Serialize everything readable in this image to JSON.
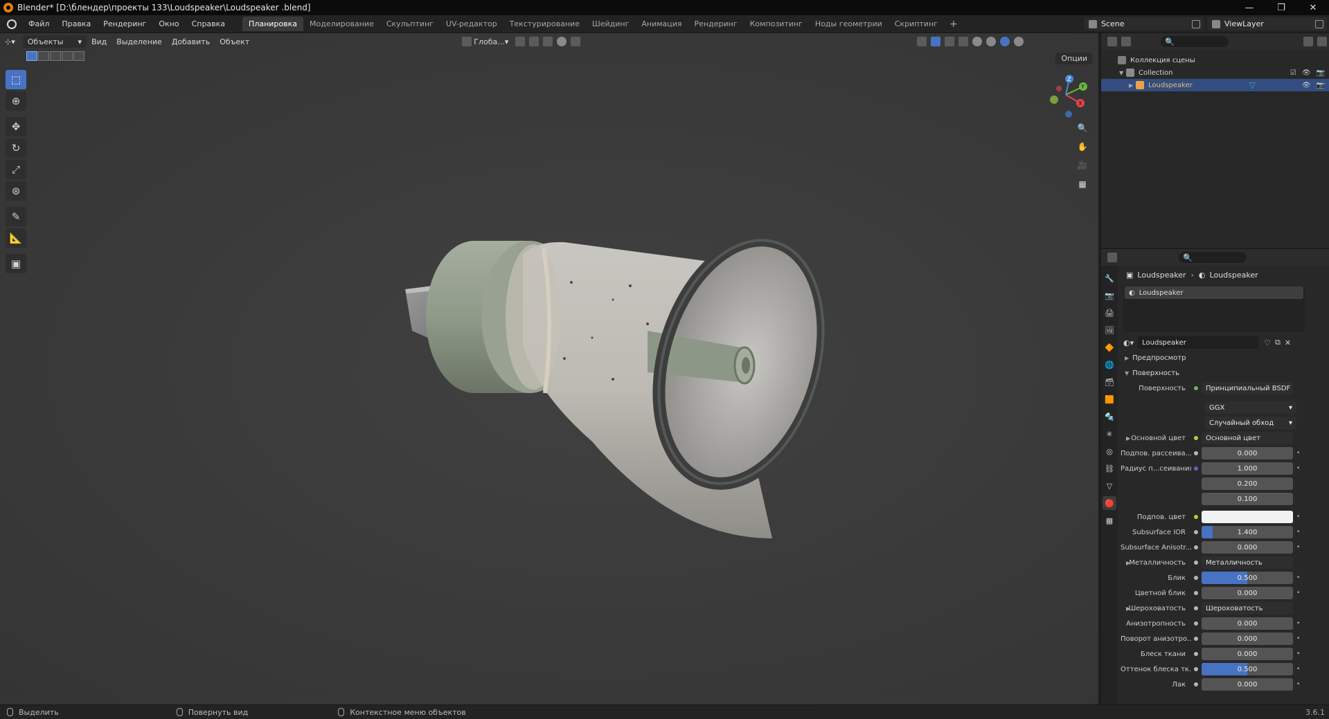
{
  "window": {
    "title": "Blender* [D:\\блендер\\проекты 133\\Loudspeaker\\Loudspeaker .blend]",
    "minimize": "—",
    "restore": "❐",
    "close": "✕"
  },
  "menu": [
    "Файл",
    "Правка",
    "Рендеринг",
    "Окно",
    "Справка"
  ],
  "workspaces": [
    {
      "label": "Планировка",
      "active": true
    },
    {
      "label": "Моделирование"
    },
    {
      "label": "Скульптинг"
    },
    {
      "label": "UV-редактор"
    },
    {
      "label": "Текстурирование"
    },
    {
      "label": "Шейдинг"
    },
    {
      "label": "Анимация"
    },
    {
      "label": "Рендеринг"
    },
    {
      "label": "Композитинг"
    },
    {
      "label": "Ноды геометрии"
    },
    {
      "label": "Скриптинг"
    }
  ],
  "workspace_add": "+",
  "scene": "Scene",
  "view_layer": "ViewLayer",
  "viewport": {
    "mode": "Объекты",
    "menus": [
      "Вид",
      "Выделение",
      "Добавить",
      "Объект"
    ],
    "orientation": "Глоба...",
    "options": "Опции"
  },
  "outliner": {
    "scene_collection": "Коллекция сцены",
    "collection": "Collection",
    "object": "Loudspeaker"
  },
  "properties": {
    "breadcrumb_object": "Loudspeaker",
    "breadcrumb_material": "Loudspeaker",
    "slot": "Loudspeaker",
    "material_name": "Loudspeaker",
    "preview_panel": "Предпросмотр",
    "surface_panel": "Поверхность",
    "rows": {
      "surface": {
        "label": "Поверхность",
        "value": "Принципиальный BSDF"
      },
      "distribution": "GGX",
      "subsurface_method": "Случайный обход",
      "base_color": {
        "label": "Основной цвет",
        "value": "Основной цвет"
      },
      "subsurface": {
        "label": "Подпов. рассеива...",
        "value": "0.000"
      },
      "subsurface_radius": {
        "label": "Радиус п...сеивания",
        "values": [
          "1.000",
          "0.200",
          "0.100"
        ]
      },
      "subsurface_color": {
        "label": "Подпов. цвет"
      },
      "subsurface_ior": {
        "label": "Subsurface IOR",
        "value": "1.400"
      },
      "subsurface_aniso": {
        "label": "Subsurface Anisotr...",
        "value": "0.000"
      },
      "metallic": {
        "label": "Металличность",
        "value": "Металличность"
      },
      "specular": {
        "label": "Блик",
        "value": "0.500"
      },
      "specular_tint": {
        "label": "Цветной блик",
        "value": "0.000"
      },
      "roughness": {
        "label": "Шероховатость",
        "value": "Шероховатость"
      },
      "anisotropic": {
        "label": "Анизотропность",
        "value": "0.000"
      },
      "anisotropic_rotation": {
        "label": "Поворот анизотро...",
        "value": "0.000"
      },
      "sheen": {
        "label": "Блеск ткани",
        "value": "0.000"
      },
      "sheen_tint": {
        "label": "Оттенок блеска тк...",
        "value": "0.500"
      },
      "clearcoat": {
        "label": "Лак",
        "value": "0.000"
      }
    },
    "fills": {
      "subsurface_ior": 0.12,
      "specular": 0.5,
      "sheen_tint": 0.5
    }
  },
  "status": {
    "select": "Выделить",
    "rotate": "Повернуть вид",
    "context": "Контекстное меню объектов",
    "version": "3.6.1"
  },
  "colors": {
    "accent": "#4873c3",
    "selected_row": "#334d80",
    "object_name": "#f0b96b"
  }
}
